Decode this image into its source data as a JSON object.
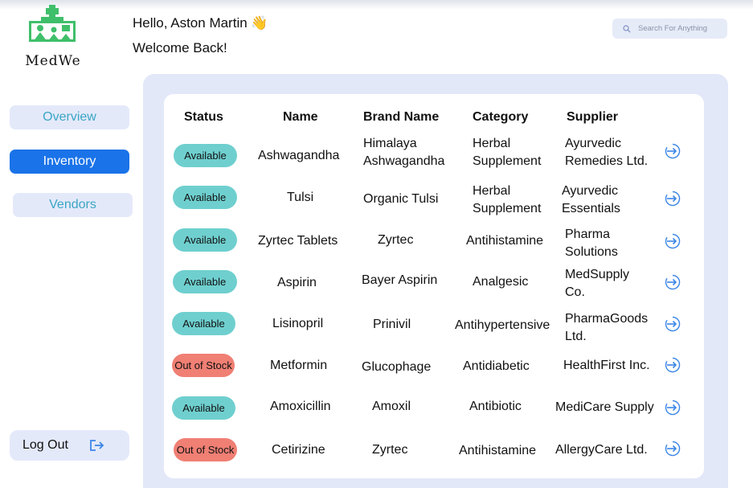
{
  "brand": {
    "name": "MedWe"
  },
  "header": {
    "greeting": "Hello, Aston Martin 👋",
    "subgreeting": "Welcome Back!"
  },
  "search": {
    "placeholder": "Search For Anything"
  },
  "sidebar": {
    "items": [
      {
        "label": "Overview",
        "active": false
      },
      {
        "label": "Inventory",
        "active": true
      },
      {
        "label": "Vendors",
        "active": false
      }
    ],
    "logout_label": "Log Out"
  },
  "table": {
    "columns": [
      "Status",
      "Name",
      "Brand Name",
      "Category",
      "Supplier"
    ],
    "rows": [
      {
        "status": "Available",
        "name": "Ashwagandha",
        "brand": [
          "Himalaya",
          "Ashwagandha"
        ],
        "category": [
          "Herbal",
          "Supplement"
        ],
        "supplier": [
          "Ayurvedic",
          "Remedies Ltd."
        ]
      },
      {
        "status": "Available",
        "name": "Tulsi",
        "brand": [
          "Organic Tulsi"
        ],
        "category": [
          "Herbal",
          "Supplement"
        ],
        "supplier": [
          "Ayurvedic",
          "Essentials"
        ]
      },
      {
        "status": "Available",
        "name": "Zyrtec Tablets",
        "brand": [
          "Zyrtec"
        ],
        "category": [
          "Antihistamine"
        ],
        "supplier": [
          "Pharma",
          "Solutions"
        ]
      },
      {
        "status": "Available",
        "name": "Aspirin",
        "brand": [
          "Bayer Aspirin"
        ],
        "category": [
          "Analgesic"
        ],
        "supplier": [
          "MedSupply",
          "Co."
        ]
      },
      {
        "status": "Available",
        "name": "Lisinopril",
        "brand": [
          "Prinivil"
        ],
        "category": [
          "Antihypertensive"
        ],
        "supplier": [
          "PharmaGoods",
          "Ltd."
        ]
      },
      {
        "status": "Out of Stock",
        "name": "Metformin",
        "brand": [
          "Glucophage"
        ],
        "category": [
          "Antidiabetic"
        ],
        "supplier": [
          "HealthFirst Inc."
        ]
      },
      {
        "status": "Available",
        "name": "Amoxicillin",
        "brand": [
          "Amoxil"
        ],
        "category": [
          "Antibiotic"
        ],
        "supplier": [
          "MediCare Supply"
        ]
      },
      {
        "status": "Out of Stock",
        "name": "Cetirizine",
        "brand": [
          "Zyrtec"
        ],
        "category": [
          "Antihistamine"
        ],
        "supplier": [
          "AllergyCare Ltd."
        ]
      }
    ]
  },
  "colors": {
    "primary": "#1a73e8",
    "available": "#6fcfcf",
    "out_of_stock": "#f07f74",
    "panel": "#e2e8f8",
    "logo_green": "#3fbf6a"
  },
  "icons": {
    "logo": "medical-house-icon",
    "search": "search-icon",
    "logout": "logout-icon",
    "row_action": "arrow-right-circle-icon"
  }
}
